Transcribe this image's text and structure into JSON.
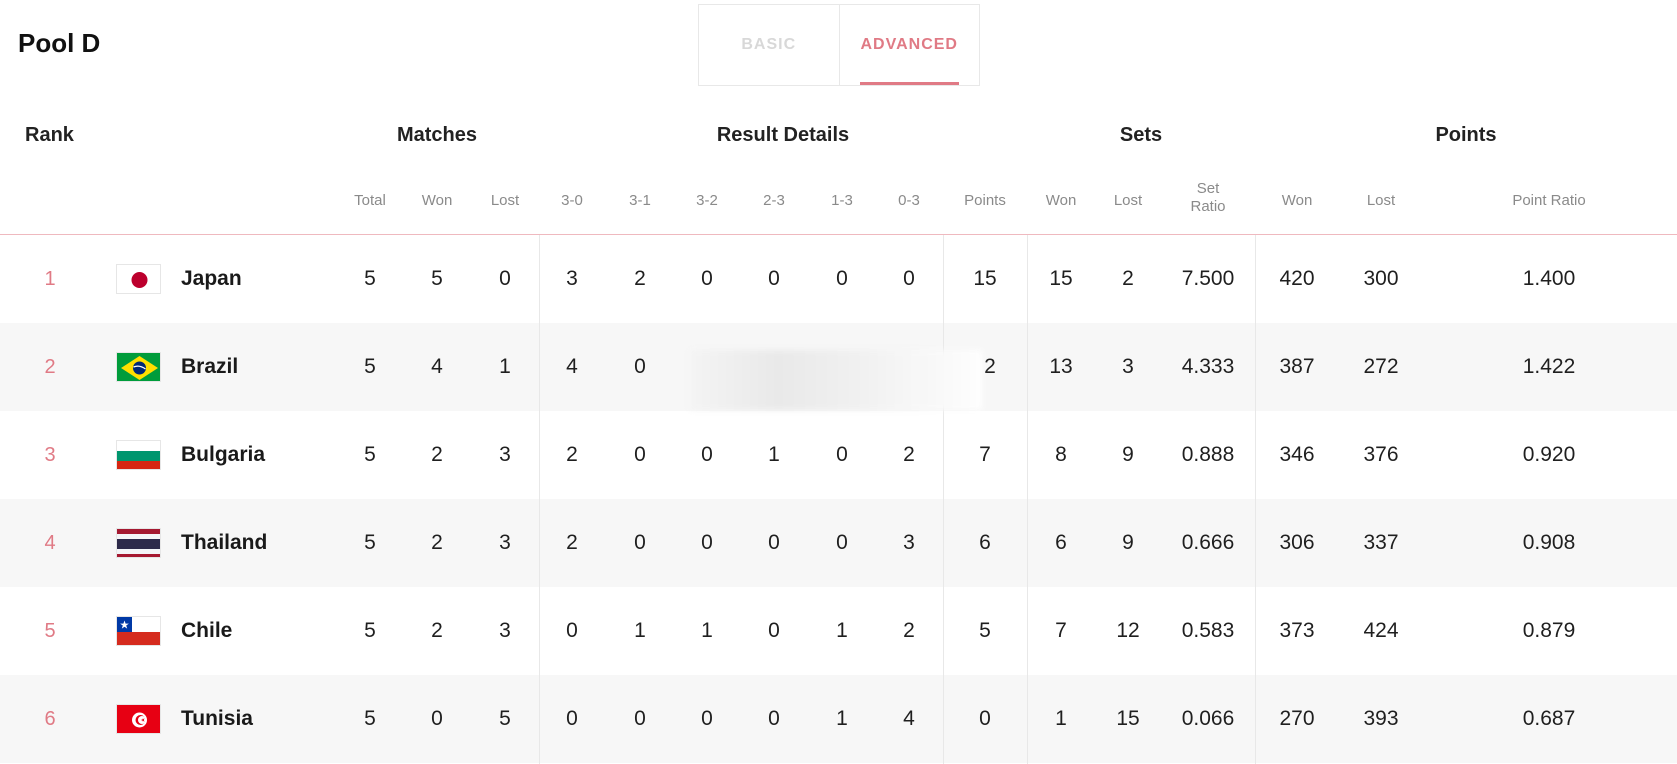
{
  "pool_title": "Pool D",
  "tabs": [
    {
      "label": "BASIC",
      "active": false
    },
    {
      "label": "ADVANCED",
      "active": true
    }
  ],
  "group_headers": {
    "rank": "Rank",
    "matches": "Matches",
    "result_details": "Result Details",
    "sets": "Sets",
    "points": "Points"
  },
  "columns": {
    "total": "Total",
    "matches_won": "Won",
    "matches_lost": "Lost",
    "r30": "3-0",
    "r31": "3-1",
    "r32": "3-2",
    "r23": "2-3",
    "r13": "1-3",
    "r03": "0-3",
    "points": "Points",
    "sets_won": "Won",
    "sets_lost": "Lost",
    "set_ratio_line1": "Set",
    "set_ratio_line2": "Ratio",
    "points_won": "Won",
    "points_lost": "Lost",
    "point_ratio": "Point Ratio"
  },
  "accent_color": "#e07a85",
  "teams": [
    {
      "rank": "1",
      "flag": "japan-flag",
      "team": "Japan",
      "total": "5",
      "won": "5",
      "lost": "0",
      "r30": "3",
      "r31": "2",
      "r32": "0",
      "r23": "0",
      "r13": "0",
      "r03": "0",
      "points": "15",
      "sets_won": "15",
      "sets_lost": "2",
      "set_ratio": "7.500",
      "pts_won": "420",
      "pts_lost": "300",
      "point_ratio": "1.400"
    },
    {
      "rank": "2",
      "flag": "brazil-flag",
      "team": "Brazil",
      "total": "5",
      "won": "4",
      "lost": "1",
      "r30": "4",
      "r31": "0",
      "r32": "",
      "r23": "",
      "r13": "",
      "r03": "",
      "points": "2",
      "sets_won": "13",
      "sets_lost": "3",
      "set_ratio": "4.333",
      "pts_won": "387",
      "pts_lost": "272",
      "point_ratio": "1.422"
    },
    {
      "rank": "3",
      "flag": "bulgaria-flag",
      "team": "Bulgaria",
      "total": "5",
      "won": "2",
      "lost": "3",
      "r30": "2",
      "r31": "0",
      "r32": "0",
      "r23": "1",
      "r13": "0",
      "r03": "2",
      "points": "7",
      "sets_won": "8",
      "sets_lost": "9",
      "set_ratio": "0.888",
      "pts_won": "346",
      "pts_lost": "376",
      "point_ratio": "0.920"
    },
    {
      "rank": "4",
      "flag": "thailand-flag",
      "team": "Thailand",
      "total": "5",
      "won": "2",
      "lost": "3",
      "r30": "2",
      "r31": "0",
      "r32": "0",
      "r23": "0",
      "r13": "0",
      "r03": "3",
      "points": "6",
      "sets_won": "6",
      "sets_lost": "9",
      "set_ratio": "0.666",
      "pts_won": "306",
      "pts_lost": "337",
      "point_ratio": "0.908"
    },
    {
      "rank": "5",
      "flag": "chile-flag",
      "team": "Chile",
      "total": "5",
      "won": "2",
      "lost": "3",
      "r30": "0",
      "r31": "1",
      "r32": "1",
      "r23": "0",
      "r13": "1",
      "r03": "2",
      "points": "5",
      "sets_won": "7",
      "sets_lost": "12",
      "set_ratio": "0.583",
      "pts_won": "373",
      "pts_lost": "424",
      "point_ratio": "0.879"
    },
    {
      "rank": "6",
      "flag": "tunisia-flag",
      "team": "Tunisia",
      "total": "5",
      "won": "0",
      "lost": "5",
      "r30": "0",
      "r31": "0",
      "r32": "0",
      "r23": "0",
      "r13": "1",
      "r03": "4",
      "points": "0",
      "sets_won": "1",
      "sets_lost": "15",
      "set_ratio": "0.066",
      "pts_won": "270",
      "pts_lost": "393",
      "point_ratio": "0.687"
    }
  ]
}
